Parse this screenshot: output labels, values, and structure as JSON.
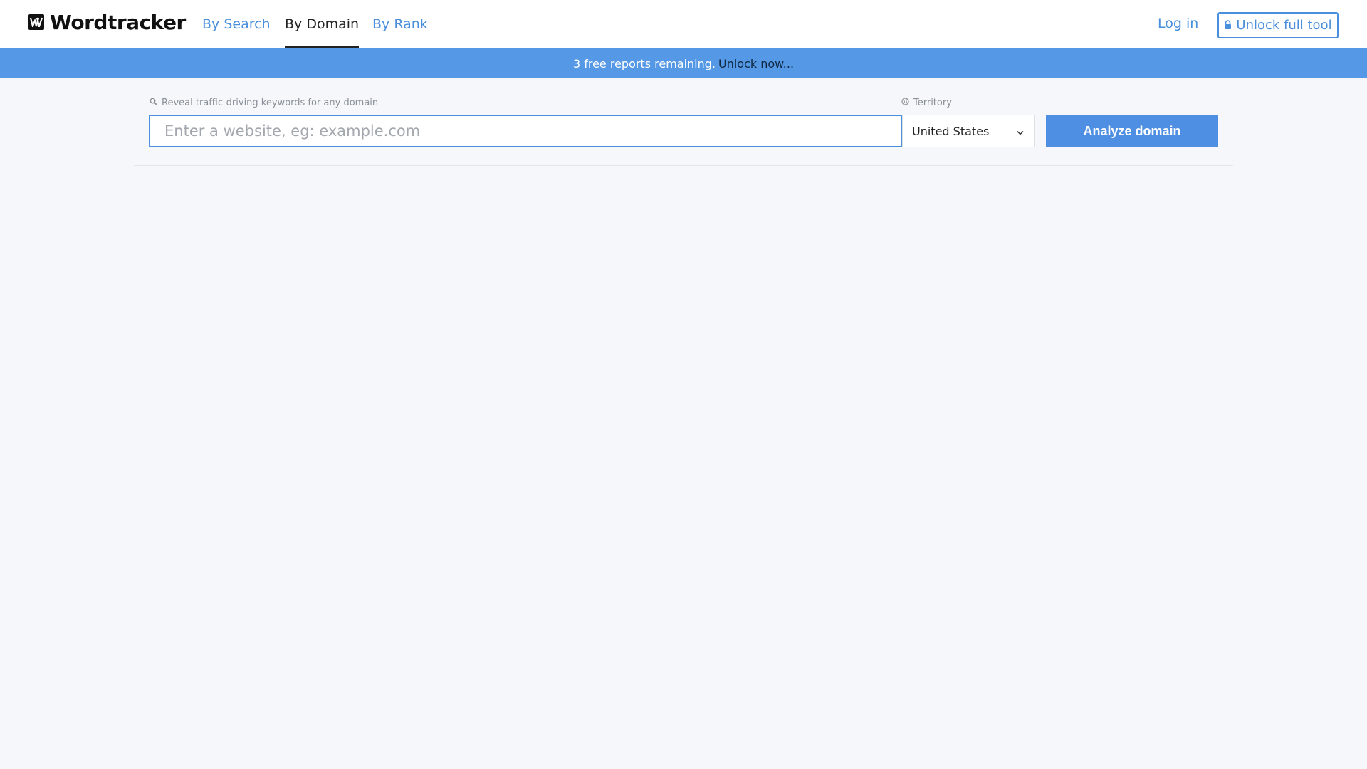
{
  "brand": {
    "name": "Wordtracker"
  },
  "nav": {
    "tabs": [
      {
        "label": "By Search"
      },
      {
        "label": "By Domain"
      },
      {
        "label": "By Rank"
      }
    ],
    "login_label": "Log in",
    "unlock_label": "Unlock full tool"
  },
  "banner": {
    "text": "3 free reports remaining.",
    "link_text": "Unlock now..."
  },
  "search": {
    "label": "Reveal traffic-driving keywords for any domain",
    "placeholder": "Enter a website, eg: example.com",
    "value": ""
  },
  "territory": {
    "label": "Territory",
    "selected": "United States"
  },
  "analyze_label": "Analyze domain",
  "colors": {
    "accent": "#4a8fdb",
    "banner": "#5598e6",
    "button": "#4f8fe3"
  },
  "icons": [
    "logo-mark-icon",
    "lock-icon",
    "search-icon",
    "globe-icon",
    "chevron-down-icon"
  ]
}
